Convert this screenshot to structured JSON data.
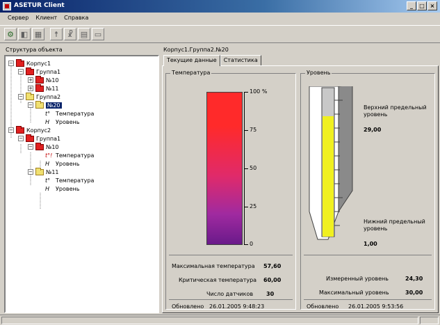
{
  "window": {
    "title": "ASETUR Client"
  },
  "menu": [
    "Сервер",
    "Клиент",
    "Справка"
  ],
  "toolbar": [
    "connect-icon",
    "disconnect-icon",
    "grid-icon",
    "run-icon",
    "walk-icon",
    "list-icon",
    "print-icon"
  ],
  "left_panel": {
    "caption": "Структура объекта",
    "tree": [
      {
        "label": "Корпус1",
        "kind": "building",
        "level": 0,
        "expander": "−"
      },
      {
        "label": "Группа1",
        "kind": "building",
        "level": 1,
        "expander": "−"
      },
      {
        "label": "№10",
        "kind": "building",
        "level": 2,
        "expander": "+"
      },
      {
        "label": "№11",
        "kind": "building",
        "level": 2,
        "expander": "+"
      },
      {
        "label": "Группа2",
        "kind": "folder",
        "level": 1,
        "expander": "−"
      },
      {
        "label": "№20",
        "kind": "folder",
        "level": 2,
        "expander": "−",
        "selected": true
      },
      {
        "label": "Температура",
        "kind": "temp",
        "level": 3,
        "sensor": "t°"
      },
      {
        "label": "Уровень",
        "kind": "level",
        "level": 3,
        "sensor": "H"
      },
      {
        "label": "Корпус2",
        "kind": "building",
        "level": 0,
        "expander": "−"
      },
      {
        "label": "Группа1",
        "kind": "building",
        "level": 1,
        "expander": "−"
      },
      {
        "label": "№10",
        "kind": "building",
        "level": 2,
        "expander": "−"
      },
      {
        "label": "Температура",
        "kind": "temp-alarm",
        "level": 3,
        "sensor": "t°!"
      },
      {
        "label": "Уровень",
        "kind": "level",
        "level": 3,
        "sensor": "H"
      },
      {
        "label": "№11",
        "kind": "folder",
        "level": 2,
        "expander": "−"
      },
      {
        "label": "Температура",
        "kind": "temp",
        "level": 3,
        "sensor": "t°"
      },
      {
        "label": "Уровень",
        "kind": "level",
        "level": 3,
        "sensor": "H"
      }
    ]
  },
  "right_panel": {
    "breadcrumb": "Корпус1.Группа2.№20",
    "tabs": [
      "Текущие данные",
      "Статистика"
    ],
    "temperature": {
      "title": "Температура",
      "scale": [
        "100 %",
        "75",
        "50",
        "25",
        "0"
      ],
      "max_label": "Максимальная температура",
      "max_value": "57,60",
      "crit_label": "Критическая температура",
      "crit_value": "60,00",
      "sensors_label": "Число датчиков",
      "sensors_value": "30",
      "updated_label": "Обновлено",
      "updated_value": "26.01.2005 9:48:23"
    },
    "level": {
      "title": "Уровень",
      "upper_label": "Верхний предельный уровень",
      "upper_value": "29,00",
      "lower_label": "Нижний предельный уровень",
      "lower_value": "1,00",
      "measured_label": "Измеренный уровень",
      "measured_value": "24,30",
      "max_label": "Максимальный уровень",
      "max_value": "30,00",
      "fill_fraction": 0.81,
      "updated_label": "Обновлено",
      "updated_value": "26.01.2005 9:53:56"
    }
  },
  "colors": {
    "selection": "#0a246a",
    "level_fill": "#f0f020",
    "titlebar": "#0a246a"
  }
}
